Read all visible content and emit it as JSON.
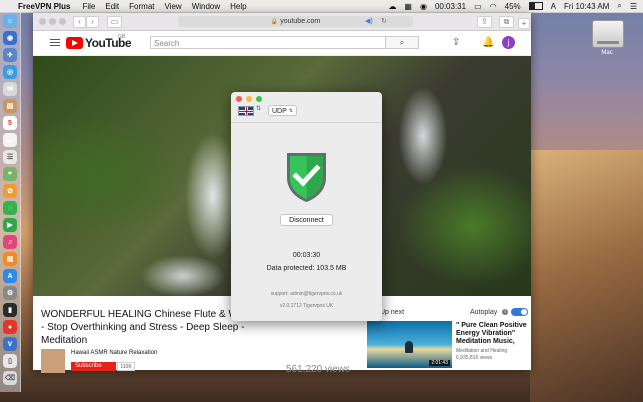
{
  "menubar": {
    "app_name": "FreeVPN Plus",
    "items": [
      "File",
      "Edit",
      "Format",
      "View",
      "Window",
      "Help"
    ],
    "timer": "00:03:31",
    "battery": "45%",
    "datetime": "Fri 10:43 AM"
  },
  "browser": {
    "url": "youtube.com"
  },
  "youtube": {
    "logo_text": "YouTube",
    "logo_country": "GB",
    "search_placeholder": "Search",
    "avatar_letter": "j",
    "video_title": "WONDERFUL HEALING Chinese Flute & Water - Stop Overthinking and Stress - Deep Sleep - Meditation",
    "channel_name": "Hawaii ASMR Nature Relaxation",
    "subscribe_label": "Subscribe",
    "subscriber_count": "110K",
    "views": "561,220 views",
    "up_next": "Up next",
    "autoplay_label": "Autoplay",
    "next_video": {
      "title": "\" Pure Clean Positive Energy Vibration\" Meditation Music,",
      "channel": "Meditation and Healing",
      "views": "6,935,816 views",
      "duration": "2:01:43"
    }
  },
  "vpn": {
    "protocol": "UDP",
    "disconnect_label": "Disconnect",
    "connection_time": "00:03:30",
    "data_protected": "Data protected: 103.5 MB",
    "support": "support: admin@tigervpns.co.uk",
    "version": "v2.0.1712 Tigervpns UK",
    "shield_color": "#2ea84a"
  },
  "desktop": {
    "drive_label": "Mac"
  }
}
